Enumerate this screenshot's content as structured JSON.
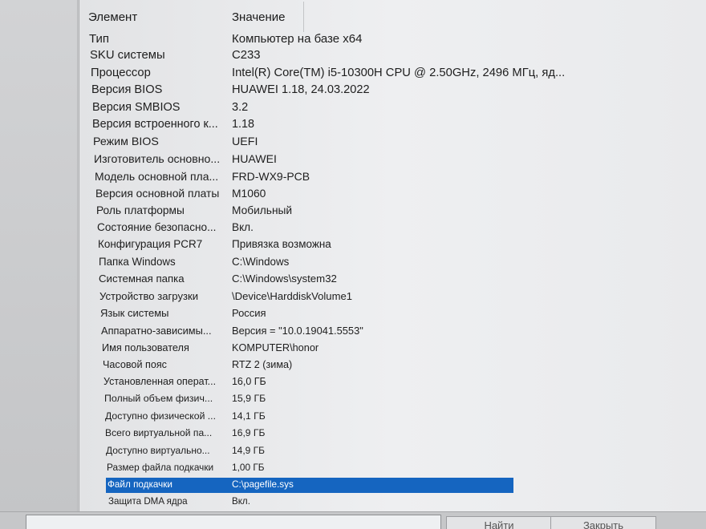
{
  "header": {
    "col_element": "Элемент",
    "col_value": "Значение"
  },
  "rows": [
    {
      "key": "Тип",
      "value": "Компьютер на базе x64"
    },
    {
      "key": "SKU системы",
      "value": "C233"
    },
    {
      "key": "Процессор",
      "value": "Intel(R) Core(TM) i5-10300H CPU @ 2.50GHz, 2496 МГц, яд..."
    },
    {
      "key": "Версия BIOS",
      "value": "HUAWEI 1.18, 24.03.2022"
    },
    {
      "key": "Версия SMBIOS",
      "value": "3.2"
    },
    {
      "key": "Версия встроенного к...",
      "value": "1.18"
    },
    {
      "key": "Режим BIOS",
      "value": "UEFI"
    },
    {
      "key": "Изготовитель основно...",
      "value": "HUAWEI"
    },
    {
      "key": "Модель основной пла...",
      "value": "FRD-WX9-PCB"
    },
    {
      "key": "Версия основной платы",
      "value": "M1060"
    },
    {
      "key": "Роль платформы",
      "value": "Мобильный"
    },
    {
      "key": "Состояние безопасно...",
      "value": "Вкл."
    },
    {
      "key": "Конфигурация PCR7",
      "value": "Привязка возможна"
    },
    {
      "key": "Папка Windows",
      "value": "C:\\Windows"
    },
    {
      "key": "Системная папка",
      "value": "C:\\Windows\\system32"
    },
    {
      "key": "Устройство загрузки",
      "value": "\\Device\\HarddiskVolume1"
    },
    {
      "key": "Язык системы",
      "value": "Россия"
    },
    {
      "key": "Аппаратно-зависимы...",
      "value": "Версия = \"10.0.19041.5553\""
    },
    {
      "key": "Имя пользователя",
      "value": "KOMPUTER\\honor"
    },
    {
      "key": "Часовой пояс",
      "value": "RTZ 2 (зима)"
    },
    {
      "key": "Установленная операт...",
      "value": "16,0 ГБ"
    },
    {
      "key": "Полный объем физич...",
      "value": "15,9 ГБ"
    },
    {
      "key": "Доступно физической ...",
      "value": "14,1 ГБ"
    },
    {
      "key": "Всего виртуальной па...",
      "value": "16,9 ГБ"
    },
    {
      "key": "Доступно виртуально...",
      "value": "14,9 ГБ"
    },
    {
      "key": "Размер файла подкачки",
      "value": "1,00 ГБ"
    },
    {
      "key": "Файл подкачки",
      "value": "C:\\pagefile.sys",
      "selected": true
    },
    {
      "key": "Защита DMA ядра",
      "value": "Вкл."
    }
  ],
  "buttons": {
    "find": "Найти",
    "close": "Закрыть"
  }
}
